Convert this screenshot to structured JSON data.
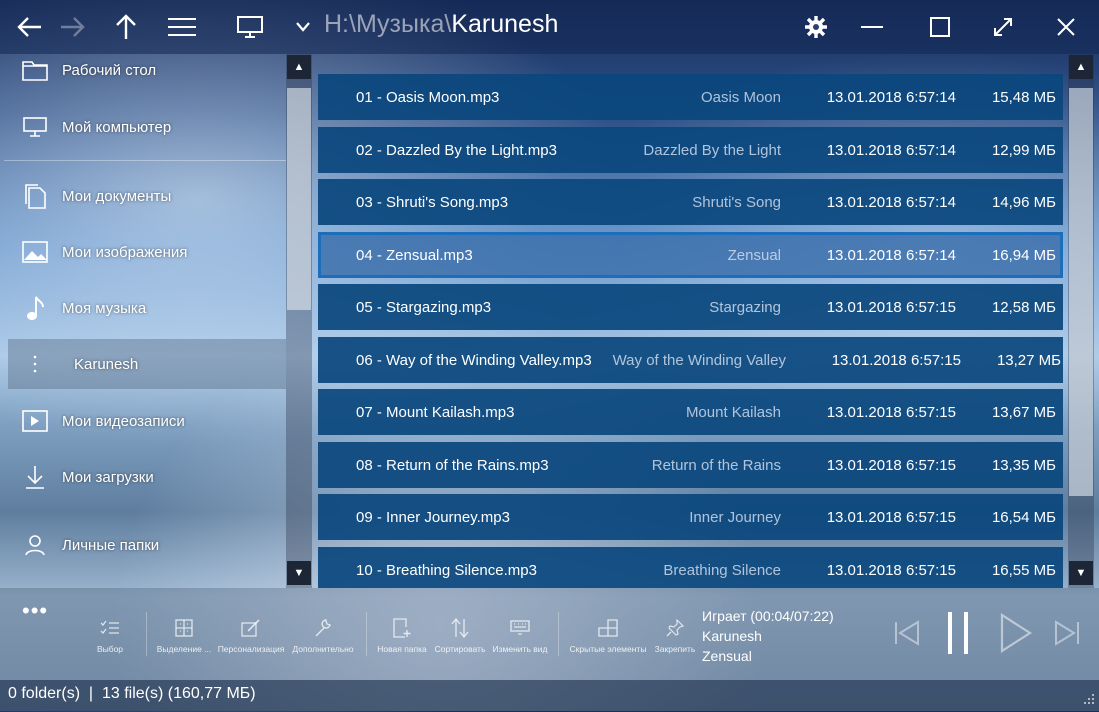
{
  "toolbar": {
    "path_prefix": "H:\\Музыка\\",
    "path_current": "Karunesh"
  },
  "sidebar": {
    "items": [
      {
        "label": "Рабочий стол",
        "icon": "folder-icon"
      },
      {
        "label": "Мой компьютер",
        "icon": "monitor-icon"
      },
      {
        "label": "Мои документы",
        "icon": "documents-icon"
      },
      {
        "label": "Мои изображения",
        "icon": "image-icon"
      },
      {
        "label": "Моя музыка",
        "icon": "music-note-icon"
      },
      {
        "label": "Karunesh",
        "icon": "dots-vertical-icon",
        "selected": true
      },
      {
        "label": "Мои видеозаписи",
        "icon": "video-icon"
      },
      {
        "label": "Мои загрузки",
        "icon": "download-icon"
      },
      {
        "label": "Личные папки",
        "icon": "person-icon"
      }
    ]
  },
  "files": [
    {
      "name": "01 - Oasis Moon.mp3",
      "title": "Oasis Moon",
      "date": "13.01.2018 6:57:14",
      "size": "15,48 МБ"
    },
    {
      "name": "02 - Dazzled By the Light.mp3",
      "title": "Dazzled By the Light",
      "date": "13.01.2018 6:57:14",
      "size": "12,99 МБ"
    },
    {
      "name": "03 - Shruti's Song.mp3",
      "title": "Shruti's Song",
      "date": "13.01.2018 6:57:14",
      "size": "14,96 МБ"
    },
    {
      "name": "04 - Zensual.mp3",
      "title": "Zensual",
      "date": "13.01.2018 6:57:14",
      "size": "16,94 МБ",
      "selected": true
    },
    {
      "name": "05 - Stargazing.mp3",
      "title": "Stargazing",
      "date": "13.01.2018 6:57:15",
      "size": "12,58 МБ"
    },
    {
      "name": "06 - Way of the Winding Valley.mp3",
      "title": "Way of the Winding Valley",
      "date": "13.01.2018 6:57:15",
      "size": "13,27 МБ"
    },
    {
      "name": "07 - Mount Kailash.mp3",
      "title": "Mount Kailash",
      "date": "13.01.2018 6:57:15",
      "size": "13,67 МБ"
    },
    {
      "name": "08 - Return of the Rains.mp3",
      "title": "Return of the Rains",
      "date": "13.01.2018 6:57:15",
      "size": "13,35 МБ"
    },
    {
      "name": "09 - Inner Journey.mp3",
      "title": "Inner Journey",
      "date": "13.01.2018 6:57:15",
      "size": "16,54 МБ"
    },
    {
      "name": "10 - Breathing Silence.mp3",
      "title": "Breathing Silence",
      "date": "13.01.2018 6:57:15",
      "size": "16,55 МБ"
    }
  ],
  "bottom_tools": [
    {
      "label": "Выбор",
      "icon": "select-list-icon"
    },
    {
      "label": "Выделение ...",
      "icon": "grid-select-icon"
    },
    {
      "label": "Персонализация",
      "icon": "edit-icon"
    },
    {
      "label": "Дополнительно",
      "icon": "wrench-icon"
    },
    {
      "label": "Новая папка",
      "icon": "new-folder-icon"
    },
    {
      "label": "Сортировать",
      "icon": "sort-icon"
    },
    {
      "label": "Изменить вид",
      "icon": "keyboard-icon"
    },
    {
      "label": "Скрытые элементы",
      "icon": "tiles-icon"
    },
    {
      "label": "Закрепить",
      "icon": "pin-icon"
    }
  ],
  "now_playing": {
    "status": "Играет (00:04/07:22)",
    "artist": "Karunesh",
    "track": "Zensual"
  },
  "status_bar": {
    "text": "0 folder(s)  |  13 file(s) (160,77 МБ)"
  }
}
